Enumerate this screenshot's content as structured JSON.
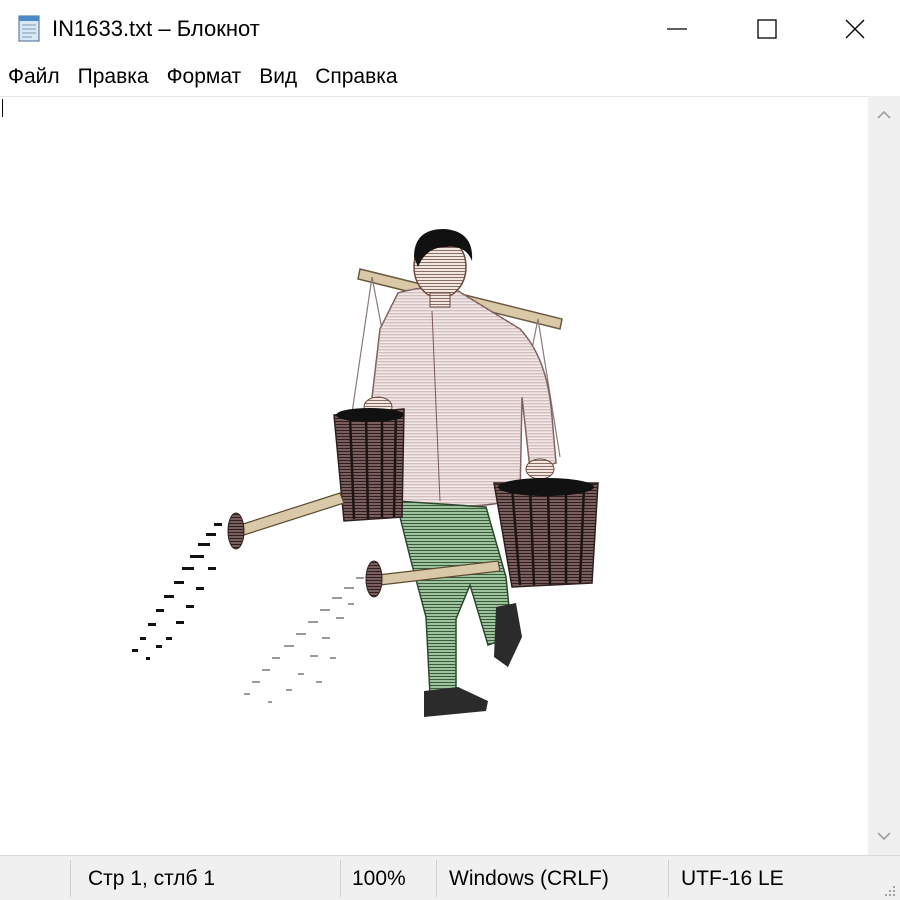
{
  "window": {
    "title": "IN1633.txt – Блокнот",
    "icon": "notepad-icon"
  },
  "caption_buttons": {
    "minimize_icon": "minimize-icon",
    "maximize_icon": "maximize-icon",
    "close_icon": "close-icon"
  },
  "menu": {
    "items": [
      {
        "label": "Файл"
      },
      {
        "label": "Правка"
      },
      {
        "label": "Формат"
      },
      {
        "label": "Вид"
      },
      {
        "label": "Справка"
      }
    ]
  },
  "editor": {
    "content_description_icon": "ascii-art-water-carrier-illustration"
  },
  "statusbar": {
    "position": "Стр 1, стлб 1",
    "zoom": "100%",
    "line_ending": "Windows (CRLF)",
    "encoding": "UTF-16 LE"
  },
  "colors": {
    "window_bg": "#ffffff",
    "chrome_bg": "#f0f0f0",
    "shirt": "#e8d8d8",
    "trousers": "#8ab38a",
    "bucket": "#6b5050",
    "pole": "#c8b89a"
  }
}
